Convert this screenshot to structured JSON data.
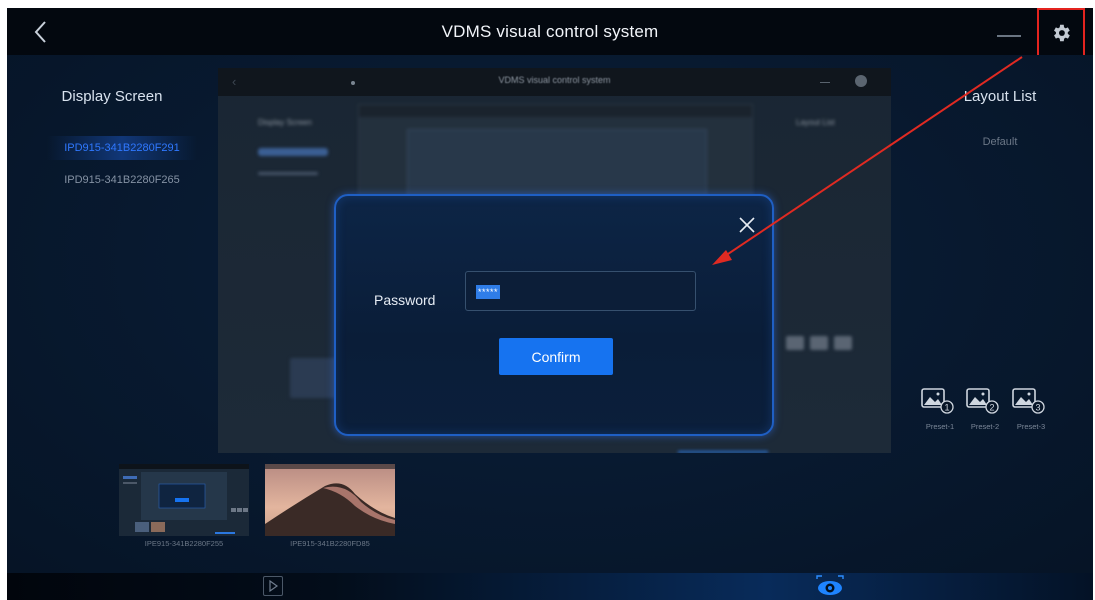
{
  "header": {
    "title": "VDMS visual control system"
  },
  "left_panel": {
    "title": "Display Screen",
    "screens": [
      {
        "label": "IPD915-341B2280F291",
        "active": true
      },
      {
        "label": "IPD915-341B2280F265",
        "active": false
      }
    ]
  },
  "preview": {
    "title": "VDMS visual control system",
    "left_label": "Display Screen",
    "right_label": "Layout List"
  },
  "dialog": {
    "password_label": "Password",
    "password_value": "*****",
    "confirm_label": "Confirm"
  },
  "right_panel": {
    "title": "Layout List",
    "layouts": [
      "Default"
    ],
    "presets": [
      {
        "label": "Preset-1",
        "number": "1"
      },
      {
        "label": "Preset-2",
        "number": "2"
      },
      {
        "label": "Preset-3",
        "number": "3"
      }
    ]
  },
  "thumbnails": [
    {
      "label": "IPE915-341B2280F255"
    },
    {
      "label": "IPE915-341B2280FD85"
    }
  ],
  "colors": {
    "accent": "#1673f0",
    "active_text": "#2f78ff",
    "highlight_box": "#e4241f",
    "annotation_arrow": "#e02a22"
  },
  "icons": {
    "back": "chevron-left-icon",
    "minimize": "minimize-icon",
    "settings": "gear-icon",
    "close": "close-icon",
    "preset": "image-preset-icon",
    "play": "play-icon",
    "eye": "eye-icon"
  }
}
